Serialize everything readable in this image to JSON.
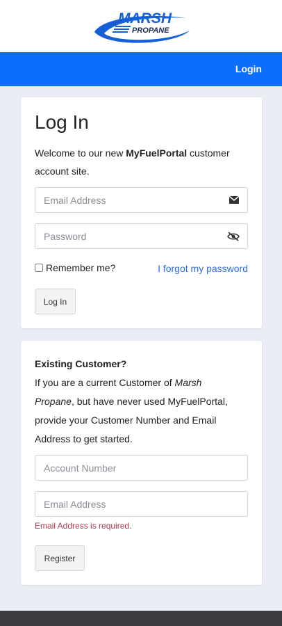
{
  "brand": {
    "logo_text_top": "MARSH",
    "logo_text_bottom": "PROPANE",
    "logo_color": "#1560d6"
  },
  "nav": {
    "login_link": "Login",
    "bar_color": "#0d6efd"
  },
  "login_card": {
    "title": "Log In",
    "welcome_prefix": "Welcome to our new ",
    "welcome_brand": "MyFuelPortal",
    "welcome_suffix": " customer account site.",
    "email_placeholder": "Email Address",
    "email_icon": "envelope-icon",
    "password_placeholder": "Password",
    "password_icon": "eye-slash-icon",
    "remember_label": "Remember me?",
    "forgot_link": "I forgot my password",
    "login_button": "Log In"
  },
  "register_card": {
    "title": "Existing Customer?",
    "desc_1": "If you are a current Customer of ",
    "desc_company": "Marsh Propane",
    "desc_2": ", but have never used MyFuelPortal, provide your Customer Number and Email Address to get started.",
    "account_placeholder": "Account Number",
    "email_placeholder": "Email Address",
    "email_error": "Email Address is required.",
    "register_button": "Register"
  },
  "colors": {
    "link": "#2f6fd6",
    "error": "#b0384a",
    "footer": "#3b3d40"
  }
}
